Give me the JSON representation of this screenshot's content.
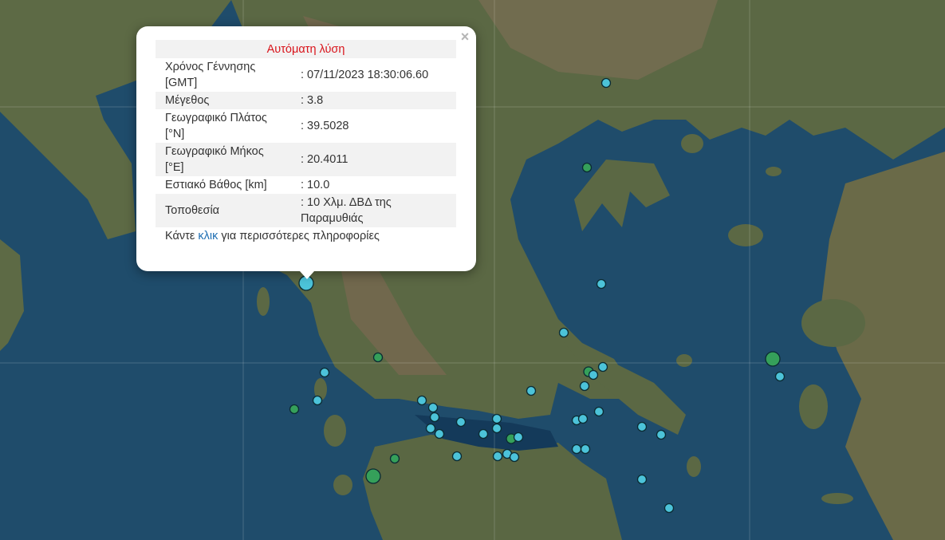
{
  "popup": {
    "title": "Αυτόματη λύση",
    "close_glyph": "×",
    "rows": [
      {
        "label": "Χρόνος Γέννησης [GMT]",
        "value": ": 07/11/2023 18:30:06.60"
      },
      {
        "label": "Μέγεθος",
        "value": ": 3.8"
      },
      {
        "label": "Γεωγραφικό Πλάτος [°N]",
        "value": ": 39.5028"
      },
      {
        "label": "Γεωγραφικό Μήκος [°E]",
        "value": ": 20.4011"
      },
      {
        "label": "Εστιακό Βάθος [km]",
        "value": ": 10.0"
      },
      {
        "label": "Τοποθεσία",
        "value": ": 10 Χλμ. ΔΒΔ της Παραμυθιάς"
      }
    ],
    "footer_prefix": "Κάντε ",
    "footer_link": "κλικ",
    "footer_suffix": " για περισσότερες πληροφορίες"
  },
  "colors": {
    "sea": "#1f4c6b",
    "land": "#5c6b45",
    "mountain": "#7c6d52",
    "quake_auto": "#4cc3d9",
    "quake_reviewed": "#35a05a",
    "selected_quake": "#4cc3d9",
    "title_red": "#d9141b",
    "link_blue": "#1f6fb3"
  }
}
